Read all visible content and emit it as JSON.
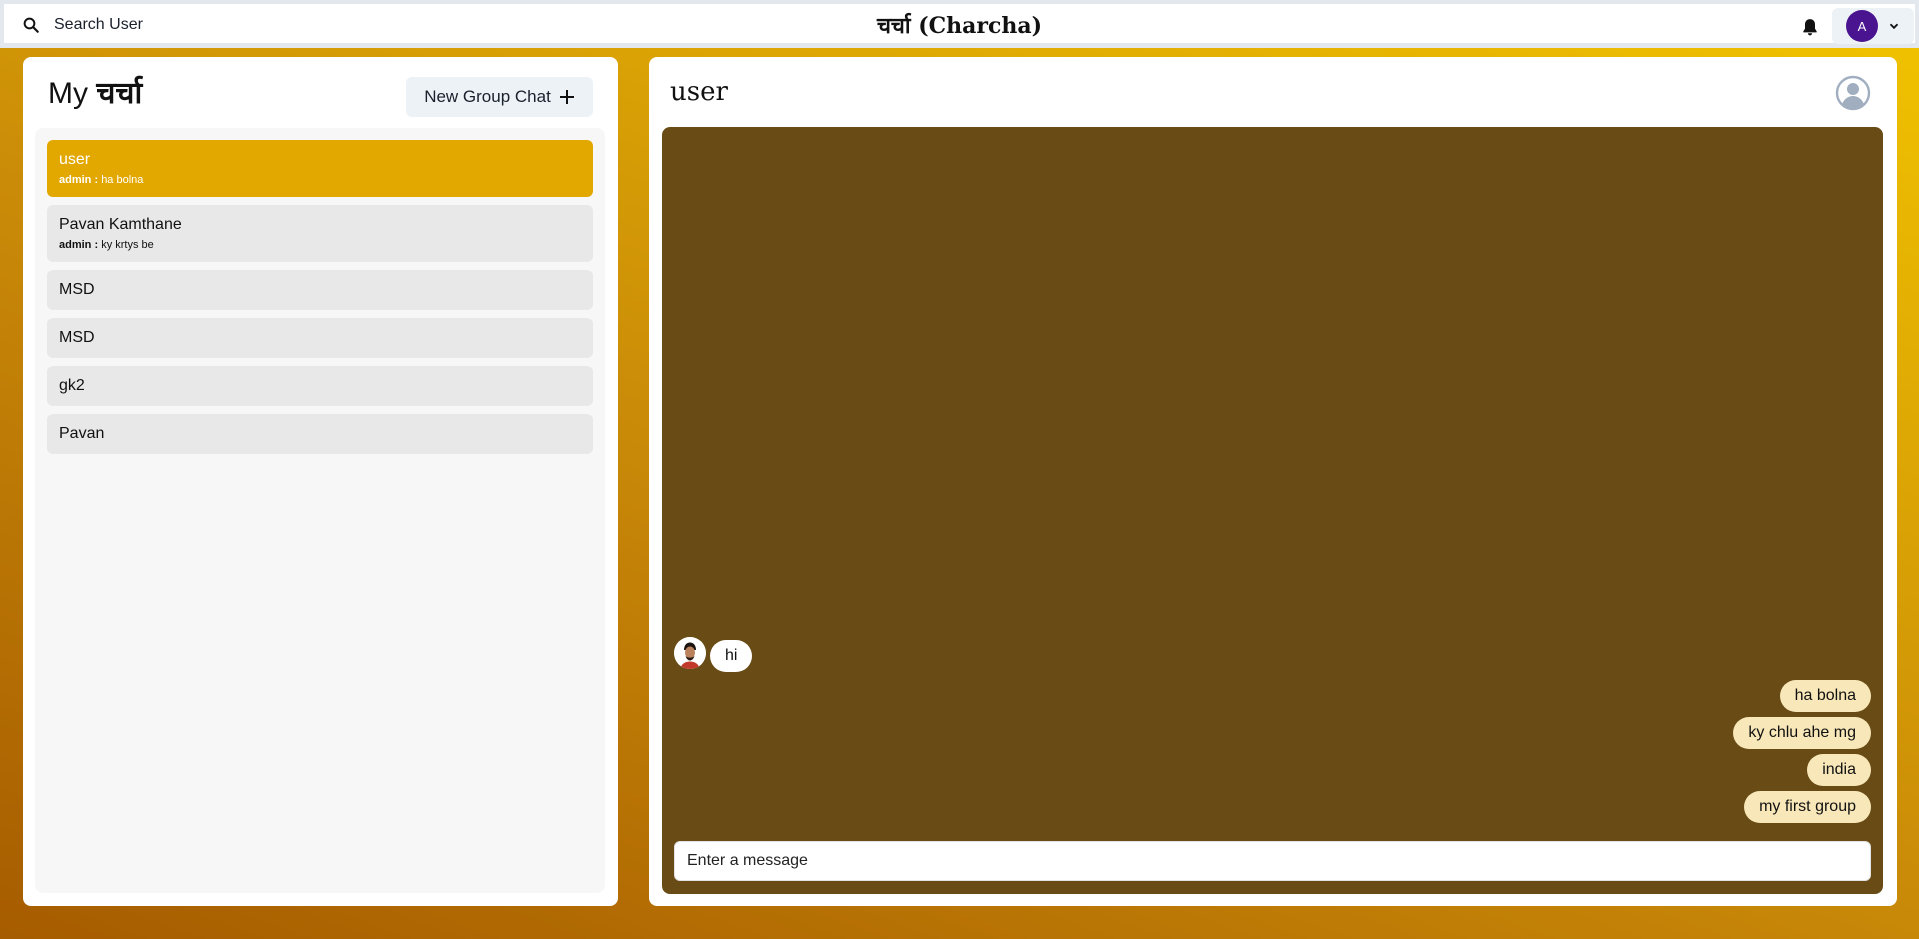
{
  "header": {
    "search_label": "Search User",
    "app_title": "चर्चा (Charcha)",
    "avatar_initial": "A",
    "accent_color": "#4a1490"
  },
  "sidebar": {
    "title_prefix": "My",
    "title_hindi": "चर्चा",
    "new_group_label": "New Group Chat",
    "chats": [
      {
        "name": "user",
        "sender": "admin :",
        "latest": "ha bolna",
        "active": true
      },
      {
        "name": "Pavan Kamthane",
        "sender": "admin :",
        "latest": "ky krtys be",
        "active": false
      },
      {
        "name": "MSD"
      },
      {
        "name": "MSD"
      },
      {
        "name": "gk2"
      },
      {
        "name": "Pavan"
      }
    ]
  },
  "chat": {
    "title": "user",
    "received": [
      {
        "text": "hi"
      }
    ],
    "sent": [
      {
        "text": "ha bolna"
      },
      {
        "text": "ky chlu ahe mg"
      },
      {
        "text": "india"
      },
      {
        "text": "my first group"
      }
    ],
    "input_placeholder": "Enter a message"
  }
}
